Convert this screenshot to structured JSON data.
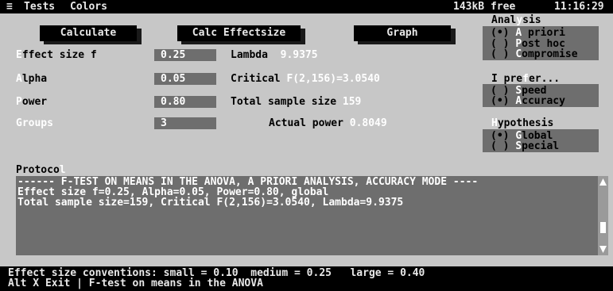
{
  "menu": {
    "icon": "≡",
    "items": [
      "Tests",
      "Colors"
    ],
    "memory": "143kB free",
    "clock": "11:16:29"
  },
  "buttons": {
    "calculate": "Calculate",
    "calc_effectsize": "Calc Effectsize",
    "graph": "Graph"
  },
  "params": {
    "effect_size": {
      "hot": "E",
      "label": "ffect size f",
      "value": "0.25"
    },
    "alpha": {
      "hot": "A",
      "label": "lpha",
      "value": "0.05"
    },
    "power": {
      "hot": "P",
      "label": "ower",
      "value": "0.80"
    },
    "groups": {
      "label": "Groups",
      "value": "3"
    }
  },
  "results": {
    "lambda_label": "Lambda",
    "lambda_value": "9.9375",
    "critical_label": "Critical",
    "critical_value": "F(2,156)=3.0540",
    "total_label": "Total sample size",
    "total_value": "159",
    "actual_label": "Actual power",
    "actual_value": "0.8049"
  },
  "analysis": {
    "title_a": "Anal",
    "title_hot": "y",
    "title_b": "sis",
    "options": [
      {
        "mark": "(•) ",
        "hot": "A",
        "rest": " priori"
      },
      {
        "mark": "( ) ",
        "hot": "P",
        "rest": "ost hoc"
      },
      {
        "mark": "( ) ",
        "hot": "C",
        "rest": "ompromise"
      }
    ]
  },
  "prefer": {
    "title_a": "I pre",
    "title_hot": "f",
    "title_b": "er...",
    "options": [
      {
        "mark": "( ) ",
        "hot": "S",
        "rest": "peed"
      },
      {
        "mark": "(•) ",
        "hot": "A",
        "rest": "ccuracy"
      }
    ]
  },
  "hypothesis": {
    "title_hot": "H",
    "title_b": "ypothesis",
    "options": [
      {
        "mark": "(•) ",
        "hot": "G",
        "rest": "lobal"
      },
      {
        "mark": "( ) ",
        "hot": "S",
        "rest": "pecial"
      }
    ]
  },
  "protocol": {
    "title_a": "Protoco",
    "title_hot": "l",
    "lines": [
      "------ F-TEST ON MEANS IN THE ANOVA, A PRIORI ANALYSIS, ACCURACY MODE ----",
      "Effect size f=0.25, Alpha=0.05, Power=0.80, global",
      "Total sample size=159, Critical F(2,156)=3.0540, Lambda=9.9375"
    ]
  },
  "status": {
    "line1": "Effect size conventions: small = 0.10  medium = 0.25   large = 0.40",
    "line2": "Alt X Exit | F-test on means in the ANOVA"
  }
}
